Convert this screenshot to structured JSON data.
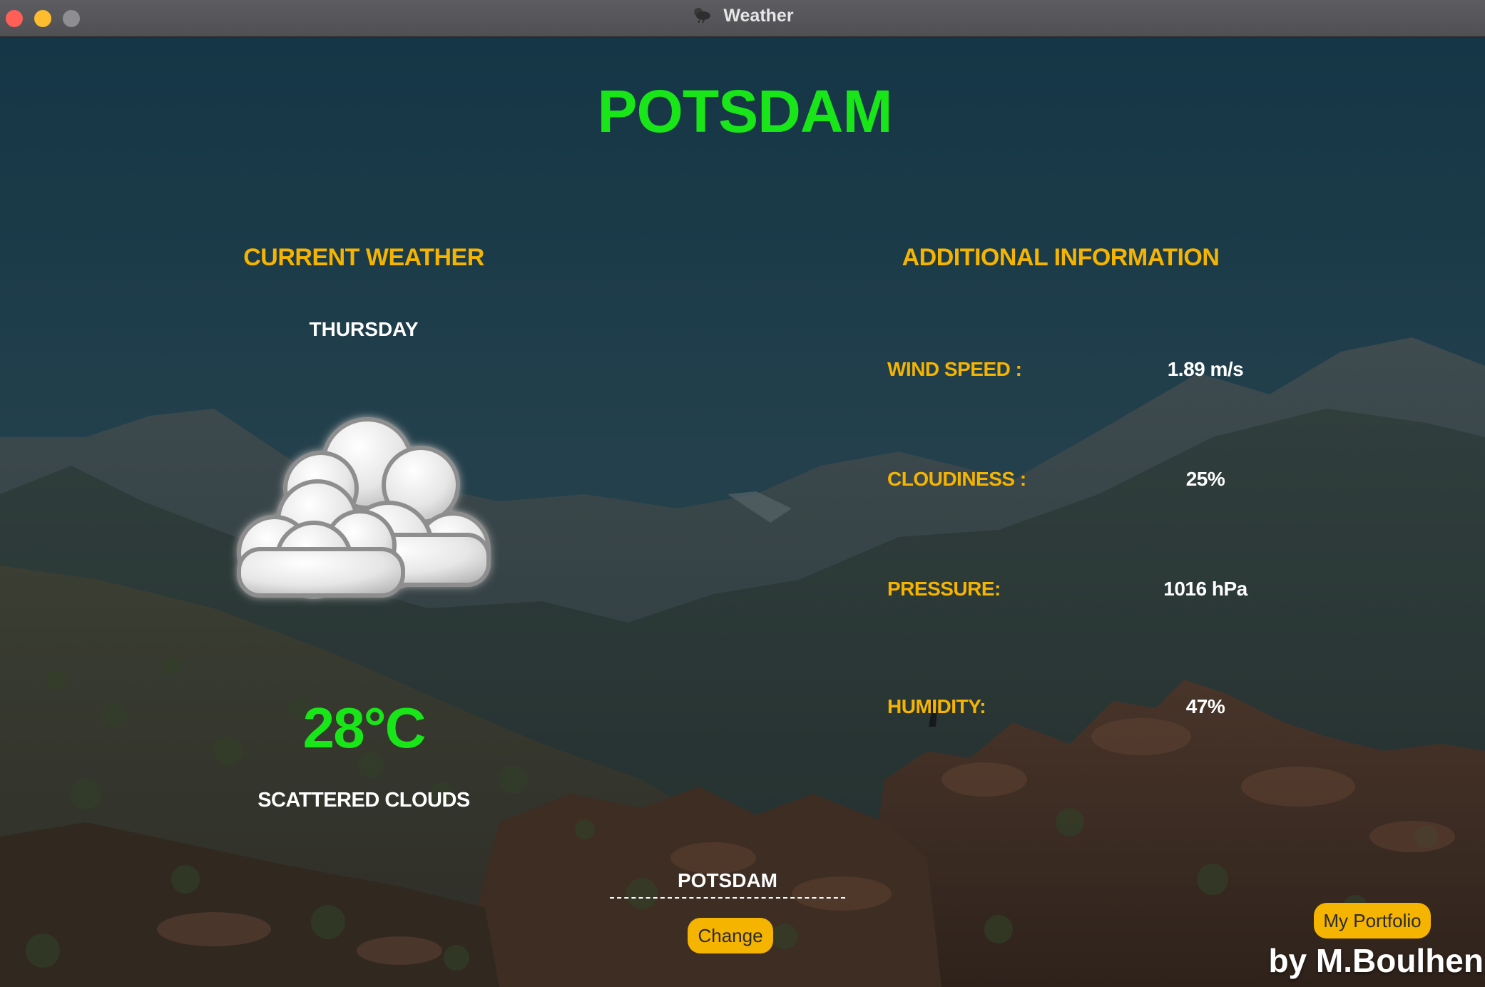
{
  "window": {
    "title": "Weather"
  },
  "header": {
    "city": "POTSDAM"
  },
  "current": {
    "heading": "CURRENT WEATHER",
    "day": "THURSDAY",
    "temperature": "28°C",
    "description": "SCATTERED CLOUDS",
    "icon": "scattered-clouds-icon"
  },
  "additional": {
    "heading": "ADDITIONAL INFORMATION",
    "rows": [
      {
        "label": "WIND SPEED :",
        "value": "1.89 m/s"
      },
      {
        "label": "CLOUDINESS :",
        "value": "25%"
      },
      {
        "label": "PRESSURE:",
        "value": "1016 hPa"
      },
      {
        "label": "HUMIDITY:",
        "value": "47%"
      }
    ]
  },
  "controls": {
    "city_input_value": "POTSDAM",
    "change_label": "Change",
    "portfolio_label": "My Portfolio"
  },
  "footer": {
    "byline": "by M.Boulhen"
  },
  "colors": {
    "accent_green": "#19e619",
    "accent_orange": "#f5b400",
    "text_white": "#ffffff"
  }
}
